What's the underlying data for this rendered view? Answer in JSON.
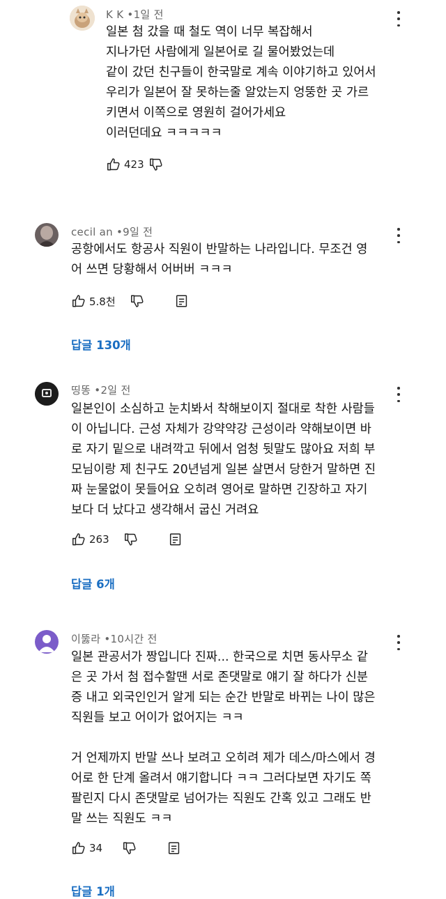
{
  "comments": [
    {
      "author": "K K",
      "time": "1일 전",
      "body": "일본 첨 갔을 때 철도 역이 너무 복잡해서\n지나가던 사람에게 일본어로 길 물어봤었는데\n같이 갔던 친구들이 한국말로 계속 이야기하고 있어서\n우리가 일본어 잘 못하는줄 알았는지 엉뚱한 곳 가르\n키면서 이쪽으로 영원히 걸어가세요\n이러던데요 ㅋㅋㅋㅋㅋ",
      "likes": "423",
      "replies": ""
    },
    {
      "author": "cecil an",
      "time": "9일 전",
      "body": "공항에서도 항공사 직원이 반말하는 나라입니다. 무조건 영\n어 쓰면 당황해서 어버버 ㅋㅋㅋ",
      "likes": "5.8천",
      "replies": "답글 130개"
    },
    {
      "author": "띵똥",
      "time": "2일 전",
      "body": "일본인이 소심하고 눈치봐서 착해보이지 절대로 착한 사람들\n이 아닙니다. 근성 자체가 강약약강 근성이라 약해보이면 바\n로 자기 밑으로 내려깍고 뒤에서 엄청 뒷말도 많아요 저희 부\n모님이랑 제 친구도 20년넘게 일본 살면서 당한거 말하면 진\n짜 눈물없이 못들어요 오히려 영어로 말하면 긴장하고 자기\n보다 더 났다고 생각해서 굽신 거려요",
      "likes": "263",
      "replies": "답글 6개"
    },
    {
      "author": "이뚫라",
      "time": "10시간 전",
      "body": "일본 관공서가 짱입니다 진짜... 한국으로 치면 동사무소 같\n은 곳 가서 첨 접수할땐 서로 존댓말로 얘기 잘 하다가 신분\n증 내고 외국인인거 알게 되는 순간 반말로 바뀌는 나이 많은\n직원들 보고 어이가 없어지는 ㅋㅋ\n\n거 언제까지 반말 쓰나 보려고 오히려 제가 데스/마스에서 경\n어로 한 단계 올려서 얘기합니다 ㅋㅋ 그러다보면 자기도 쪽\n팔린지 다시 존댓말로 넘어가는 직원도 간혹 있고 그래도 반\n말 쓰는 직원도 ㅋㅋ",
      "likes": "34",
      "replies": "답글 1개"
    }
  ],
  "separator": "•",
  "icons": {
    "like": "thumbs-up-icon",
    "dislike": "thumbs-down-icon",
    "reply": "reply-comment-icon",
    "menu": "more-vert-icon"
  },
  "colors": {
    "reply_link": "#1a6ec2",
    "meta_text": "#666666",
    "avatar_placeholder": "#7b5cc9"
  }
}
